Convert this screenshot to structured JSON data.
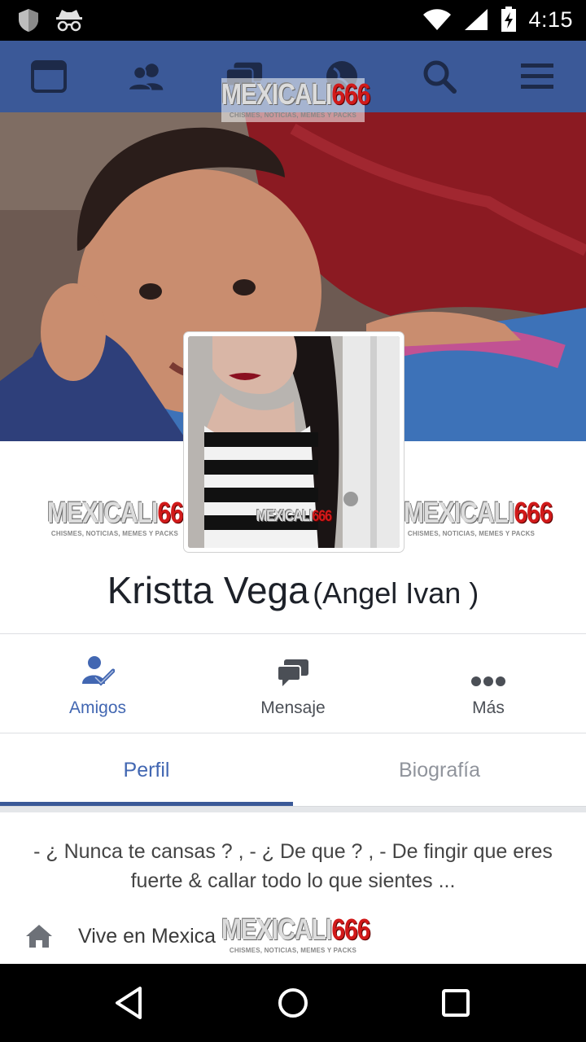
{
  "status_bar": {
    "time": "4:15",
    "icons": [
      "shield-icon",
      "incognito-icon",
      "wifi-icon",
      "signal-icon",
      "battery-charging-icon"
    ]
  },
  "nav_bar": {
    "color": "#3b5998",
    "items": [
      "news-feed-icon",
      "friends-icon",
      "messages-icon",
      "notifications-globe-icon",
      "search-icon",
      "menu-icon"
    ]
  },
  "watermark": {
    "part_a": "MEXICALI",
    "part_b": "666",
    "subtitle": "CHISMES, NOTICIAS, MEMES Y PACKS"
  },
  "profile": {
    "name": "Kristta Vega",
    "alternate_name": "(Angel Ivan )"
  },
  "actions": [
    {
      "label": "Amigos",
      "icon": "friends-check-icon",
      "color": "#4267b2"
    },
    {
      "label": "Mensaje",
      "icon": "message-bubbles-icon",
      "color": "#4b4f56"
    },
    {
      "label": "Más",
      "icon": "more-dots-icon",
      "color": "#4b4f56"
    }
  ],
  "tabs": [
    {
      "label": "Perfil",
      "active": true
    },
    {
      "label": "Biografía",
      "active": false
    }
  ],
  "bio": {
    "text": "- ¿ Nunca te cansas ? , - ¿ De que ? , - De fingir que eres fuerte & callar todo lo que sientes ...",
    "lives_in": "Vive en Mexica"
  },
  "android_nav": [
    "back-icon",
    "home-circle-icon",
    "recents-square-icon"
  ]
}
